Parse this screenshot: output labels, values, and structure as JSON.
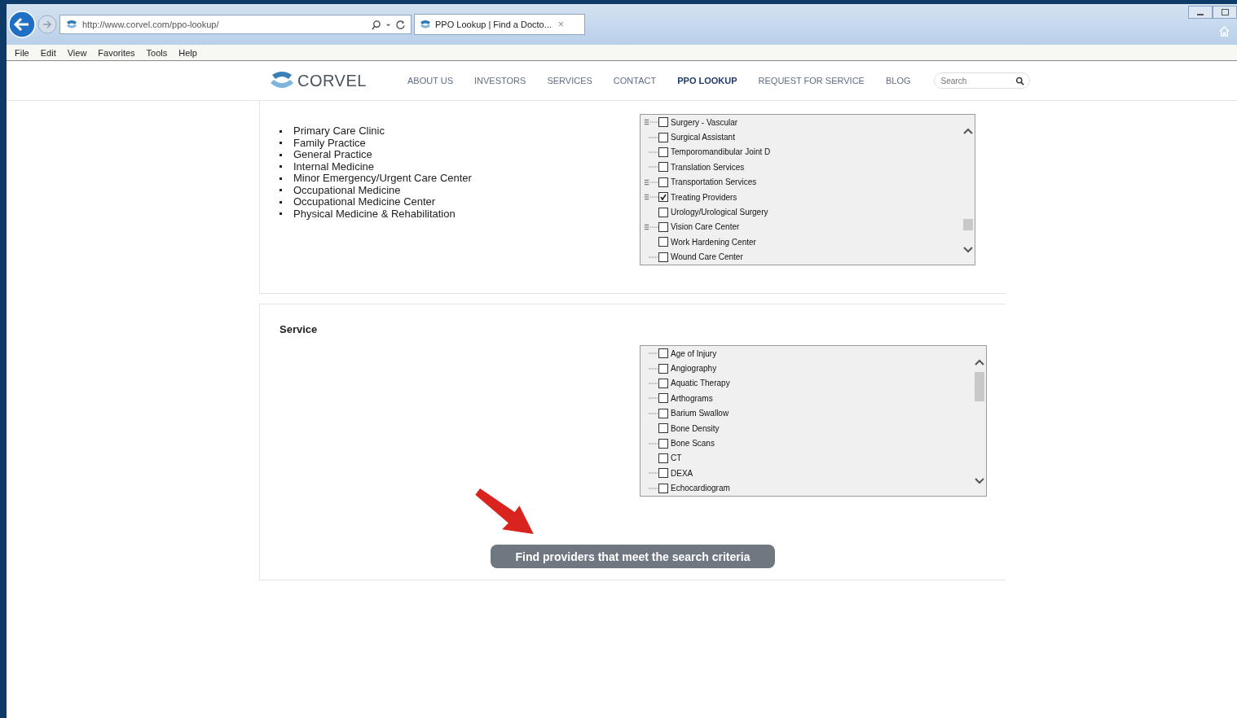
{
  "browser": {
    "address": "http://www.corvel.com/ppo-lookup/",
    "tab_title": "PPO Lookup | Find a Docto...",
    "tab_close": "×"
  },
  "menu_bar": [
    "File",
    "Edit",
    "View",
    "Favorites",
    "Tools",
    "Help"
  ],
  "site_header": {
    "logo_text": "CORVEL",
    "nav": [
      {
        "label": "ABOUT US",
        "selected": false
      },
      {
        "label": "INVESTORS",
        "selected": false
      },
      {
        "label": "SERVICES",
        "selected": false
      },
      {
        "label": "CONTACT",
        "selected": false
      },
      {
        "label": "PPO LOOKUP",
        "selected": true
      },
      {
        "label": "REQUEST FOR SERVICE",
        "selected": false
      },
      {
        "label": "BLOG",
        "selected": false
      }
    ],
    "search": {
      "placeholder": "Search"
    }
  },
  "specialty_panel": {
    "bullets": [
      "Primary Care Clinic",
      "Family Practice",
      "General Practice",
      "Internal Medicine",
      "Minor Emergency/Urgent Care Center",
      "Occupational Medicine",
      "Occupational Medicine Center",
      "Physical Medicine & Rehabilitation"
    ],
    "tree": [
      {
        "label": "Surgery - Vascular",
        "kind": "expander",
        "checked": false
      },
      {
        "label": "Surgical Assistant",
        "kind": "dotted",
        "checked": false
      },
      {
        "label": "Temporomandibular Joint D",
        "kind": "dotted",
        "checked": false
      },
      {
        "label": "Translation Services",
        "kind": "dotted",
        "checked": false
      },
      {
        "label": "Transportation Services",
        "kind": "expander",
        "checked": false
      },
      {
        "label": "Treating Providers",
        "kind": "expander",
        "checked": true
      },
      {
        "label": "Urology/Urological Surgery",
        "kind": "none",
        "checked": false
      },
      {
        "label": "Vision Care Center",
        "kind": "expander",
        "checked": false
      },
      {
        "label": "Work Hardening Center",
        "kind": "none",
        "checked": false
      },
      {
        "label": "Wound Care Center",
        "kind": "dotted",
        "checked": false
      }
    ]
  },
  "service_panel": {
    "title": "Service",
    "tree": [
      {
        "label": "Age of Injury",
        "kind": "dotted",
        "checked": false
      },
      {
        "label": "Angiography",
        "kind": "dotted",
        "checked": false
      },
      {
        "label": "Aquatic Therapy",
        "kind": "dotted",
        "checked": false
      },
      {
        "label": "Arthograms",
        "kind": "dotted",
        "checked": false
      },
      {
        "label": "Barium Swallow",
        "kind": "dotted",
        "checked": false
      },
      {
        "label": "Bone Density",
        "kind": "none",
        "checked": false
      },
      {
        "label": "Bone Scans",
        "kind": "dotted",
        "checked": false
      },
      {
        "label": "CT",
        "kind": "none",
        "checked": false
      },
      {
        "label": "DEXA",
        "kind": "dotted",
        "checked": false
      },
      {
        "label": "Echocardiogram",
        "kind": "dotted",
        "checked": false
      }
    ],
    "submit_button": "Find providers that meet the search criteria"
  }
}
